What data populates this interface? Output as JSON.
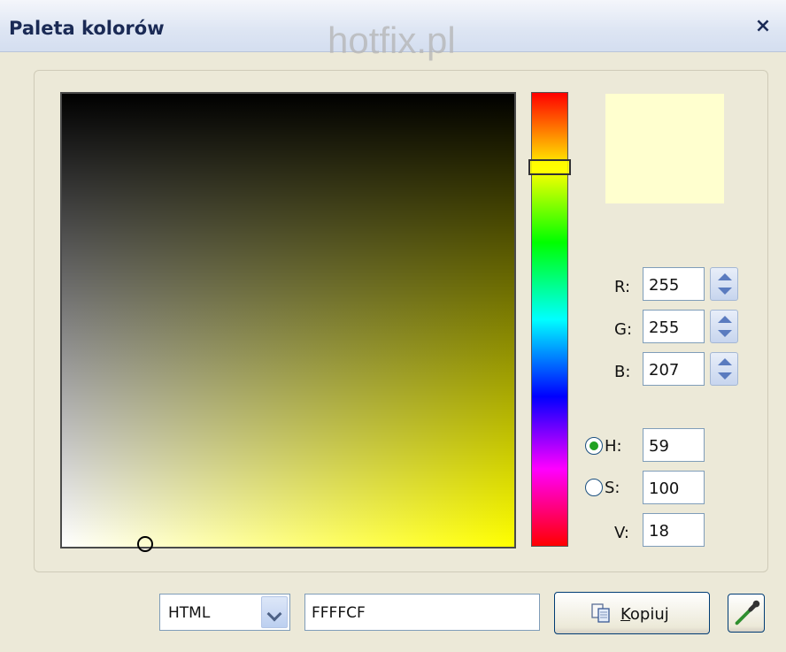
{
  "window": {
    "title": "Paleta kolorów",
    "close_glyph": "×"
  },
  "watermark": "hotfix.pl",
  "picker": {
    "selected_hex": "#FFFFCF",
    "hue_marker_fraction": 0.16,
    "sv_cursor_saturation": 0.18,
    "sv_cursor_value": 1.0
  },
  "rgb": {
    "r_label": "R:",
    "r_value": "255",
    "g_label": "G:",
    "g_value": "255",
    "b_label": "B:",
    "b_value": "207"
  },
  "hsv": {
    "h_label": "H:",
    "h_value": "59",
    "h_selected": true,
    "s_label": "S:",
    "s_value": "100",
    "s_selected": false,
    "v_label": "V:",
    "v_value": "18"
  },
  "bottom": {
    "format_selected": "HTML",
    "hex_value": "FFFFCF",
    "copy_label": "Kopiuj"
  },
  "icons": {
    "close": "close-icon",
    "copy": "copy-icon",
    "eyedropper": "eyedropper-icon",
    "dropdown": "chevron-down-icon",
    "spin_up": "arrow-up-icon",
    "spin_down": "arrow-down-icon"
  }
}
